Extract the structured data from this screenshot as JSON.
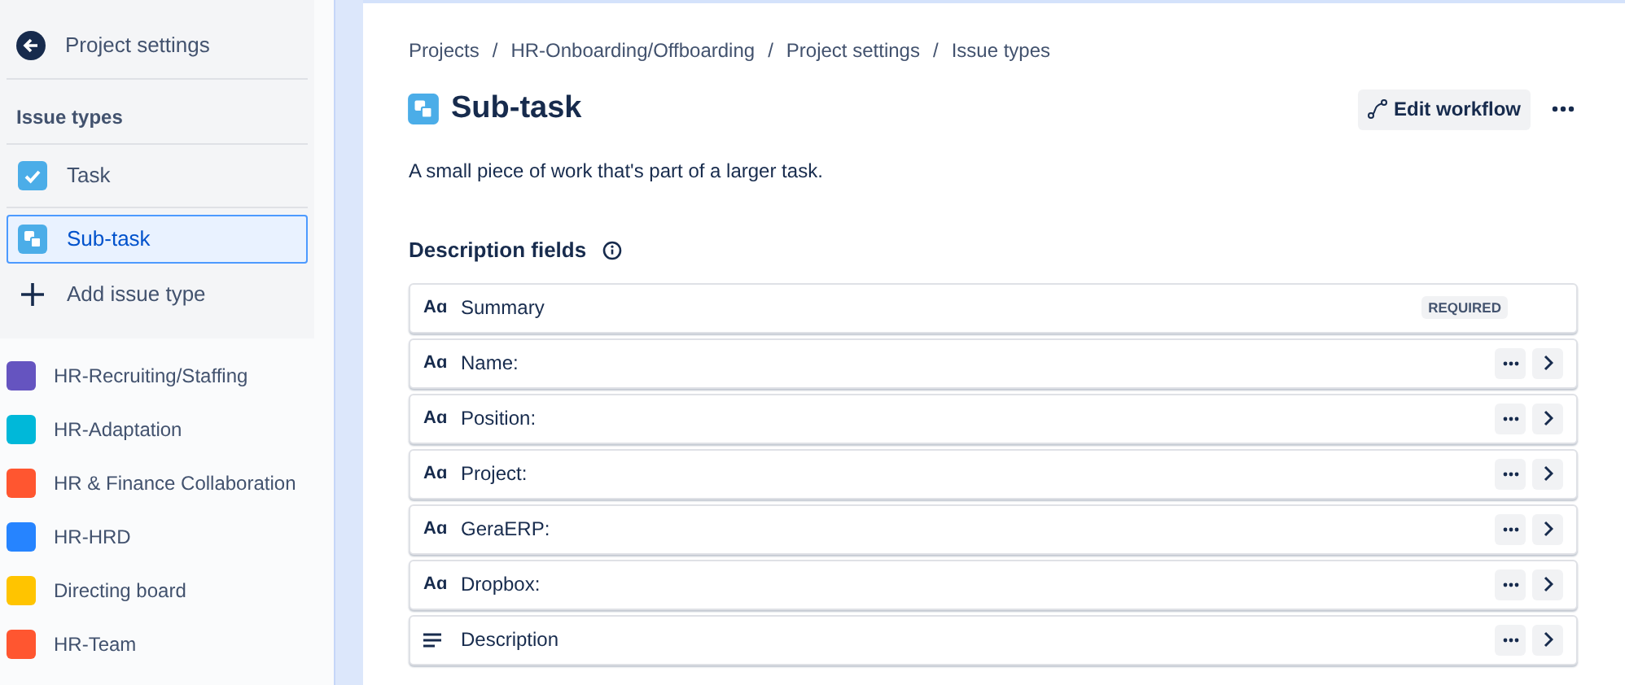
{
  "sidebar": {
    "back_link": "Project settings",
    "section_title": "Issue types",
    "issue_types": [
      {
        "label": "Task",
        "kind": "task",
        "selected": false
      },
      {
        "label": "Sub-task",
        "kind": "subtask",
        "selected": true
      },
      {
        "label": "Add issue type",
        "kind": "add",
        "selected": false
      }
    ],
    "projects": [
      {
        "name": "HR-Recruiting/Staffing",
        "color": "#6554c0"
      },
      {
        "name": "HR-Adaptation",
        "color": "#00b8d9"
      },
      {
        "name": "HR & Finance Collaboration",
        "color": "#ff5630"
      },
      {
        "name": "HR-HRD",
        "color": "#2684ff"
      },
      {
        "name": "Directing board",
        "color": "#ffc400"
      },
      {
        "name": "HR-Team",
        "color": "#ff5630"
      }
    ]
  },
  "breadcrumbs": [
    "Projects",
    "HR-Onboarding/Offboarding",
    "Project settings",
    "Issue types"
  ],
  "breadcrumb_separators": [
    "/",
    "/",
    "/"
  ],
  "header": {
    "title": "Sub-task",
    "edit_button": "Edit workflow",
    "description": "A small piece of work that's part of a larger task."
  },
  "fields_section": {
    "title": "Description fields",
    "fields": [
      {
        "name": "Summary",
        "kind": "text",
        "icon": "Aɑ",
        "required": true,
        "badge": "REQUIRED"
      },
      {
        "name": "Name:",
        "kind": "text",
        "icon": "Aɑ",
        "required": false
      },
      {
        "name": "Position:",
        "kind": "text",
        "icon": "Aɑ",
        "required": false
      },
      {
        "name": "Project:",
        "kind": "text",
        "icon": "Aɑ",
        "required": false
      },
      {
        "name": "GeraERP:",
        "kind": "text",
        "icon": "Aɑ",
        "required": false
      },
      {
        "name": "Dropbox:",
        "kind": "text",
        "icon": "Aɑ",
        "required": false
      },
      {
        "name": "Description",
        "kind": "paragraph",
        "required": false
      }
    ]
  }
}
